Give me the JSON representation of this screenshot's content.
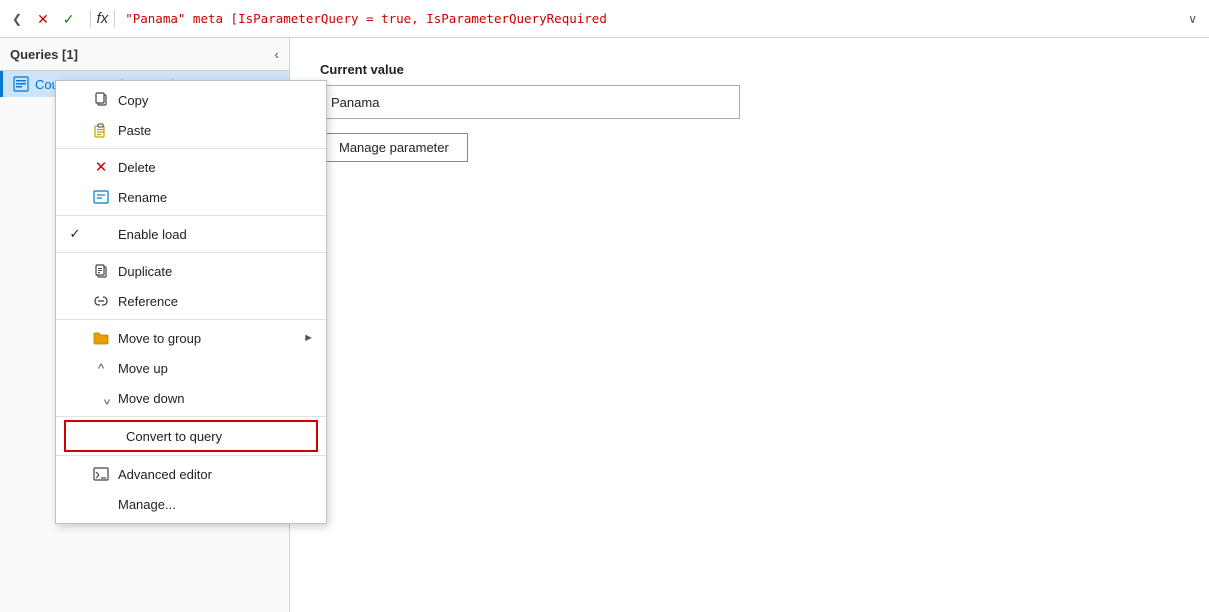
{
  "formulaBar": {
    "chevron": "❮",
    "cancelBtn": "✕",
    "confirmBtn": "✓",
    "fxLabel": "fx",
    "formula": "\"Panama\" meta [IsParameterQuery = true, IsParameterQueryRequired",
    "expandBtn": "∨"
  },
  "queriesPanel": {
    "title": "Queries [1]",
    "collapseBtn": "‹",
    "queryItem": {
      "label": "CountryName (Panama)"
    }
  },
  "contextMenu": {
    "items": [
      {
        "id": "copy",
        "label": "Copy",
        "icon": "copy",
        "check": ""
      },
      {
        "id": "paste",
        "label": "Paste",
        "icon": "paste",
        "check": ""
      },
      {
        "id": "sep1"
      },
      {
        "id": "delete",
        "label": "Delete",
        "icon": "delete-x",
        "check": ""
      },
      {
        "id": "rename",
        "label": "Rename",
        "icon": "rename",
        "check": ""
      },
      {
        "id": "sep2"
      },
      {
        "id": "enable-load",
        "label": "Enable load",
        "icon": "",
        "check": "✓"
      },
      {
        "id": "sep3"
      },
      {
        "id": "duplicate",
        "label": "Duplicate",
        "icon": "duplicate",
        "check": ""
      },
      {
        "id": "reference",
        "label": "Reference",
        "icon": "reference",
        "check": ""
      },
      {
        "id": "sep4"
      },
      {
        "id": "move-to-group",
        "label": "Move to group",
        "icon": "folder",
        "check": "",
        "hasArrow": true
      },
      {
        "id": "move-up",
        "label": "Move up",
        "icon": "move-up",
        "check": ""
      },
      {
        "id": "move-down",
        "label": "Move down",
        "icon": "move-down",
        "check": ""
      },
      {
        "id": "sep5"
      },
      {
        "id": "convert-to-query",
        "label": "Convert to query",
        "icon": "",
        "check": "",
        "highlighted": true
      },
      {
        "id": "sep6"
      },
      {
        "id": "advanced-editor",
        "label": "Advanced editor",
        "icon": "adv-editor",
        "check": ""
      },
      {
        "id": "manage",
        "label": "Manage...",
        "icon": "",
        "check": ""
      }
    ]
  },
  "mainPanel": {
    "currentValueLabel": "Current value",
    "currentValueInput": "Panama",
    "manageParamBtn": "Manage parameter"
  }
}
